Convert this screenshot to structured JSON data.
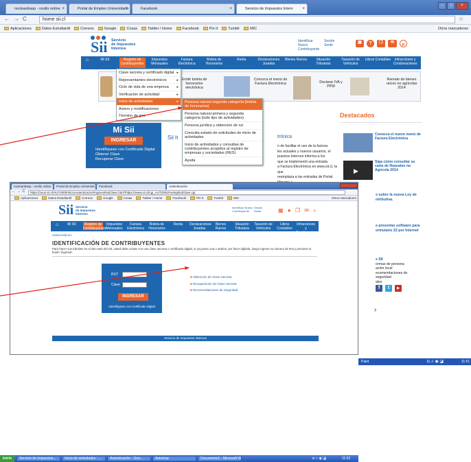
{
  "browser1": {
    "tabs": [
      "nocleanbasp - nosllo online",
      "Portal de Empleo Universitario",
      "Facebook",
      "Servicio de Impuestos Intern"
    ],
    "url": "home sii.cl",
    "bookmarks": [
      "Aplicaciones",
      "Datos Estudiantil",
      "Correos",
      "Google",
      "Cosas",
      "Twitter / Home",
      "Facebook",
      "Pin It",
      "Tumblr",
      "MIC"
    ],
    "other_bookmarks": "Otros marcadores"
  },
  "site": {
    "brand": [
      "Servicio",
      "de Impuestos",
      "Internos"
    ],
    "top_links": [
      "Identificar Nuevo Contribuyente",
      "Sesión Sentir"
    ],
    "nav": [
      "Mi SII",
      "Registro de Contribuyentes",
      "Impuestos Mensuales",
      "Factura Electrónica",
      "Boleta de Honorarios",
      "Renta",
      "Declaraciones Juradas",
      "Bienes Raíces",
      "Situación Tributaria",
      "Tasación de Vehículos",
      "Libros Contables",
      "Infracciones y Condonaciones"
    ]
  },
  "menu": {
    "items": [
      "Clave secreta y certificado digital",
      "Representantes electrónicos",
      "Ciclo de vida de una empresa",
      "Verificación de actividad",
      "Inicio de actividades",
      "Avisos y modificaciones",
      "Término de giro"
    ],
    "highlighted": 4,
    "submenu": [
      "Persona natural segunda categoría (boleta de honorarios)",
      "Persona natural primera y segunda categoría (todo tipo de actividades)",
      "Persona jurídica y obtención de rut",
      "Consulta estado de solicitudes de inicio de actividades",
      "Inicio de actividades y consultas de contribuyentes acogidos al registro de empresas y sociedades (RES)",
      "Ayuda"
    ]
  },
  "banners": [
    "Emitir boleta de honorarios electrónica",
    "Conozca el menú de Factura Electrónica",
    "Declarar IVA y PPM",
    "Remate de bienes raíces no agrícolas 2014"
  ],
  "mi_sii": {
    "title": "Mi Sii",
    "button": "INGRESAR",
    "links": [
      "Identifíquese con Certificado Digital",
      "Obtener Clave",
      "Recuperar Clave"
    ]
  },
  "sii_body": {
    "title": "Sii h",
    "heading": "trónica",
    "lines": [
      "n de facilitar el uso de la factura",
      "les actuales y nuevos usuarios, el",
      "puestos Internos informa a los",
      "que se implementó una entrada",
      "a Factura Electrónica en www.sii.cl, la que",
      "reemplaza a las entradas de Portal Mipyme y"
    ]
  },
  "destacados": {
    "title": "Destacados",
    "items": [
      "Conozca el nuevo menú de Factura Electrónica",
      "Siga cómo consultar su carta de Reavalúo no Agrícola 2014",
      "s sobre la nueva Ley de ntributiva.",
      "e presentar software para ormulario 22 por Internet"
    ],
    "extra": [
      "s SII",
      "ormas de persona",
      "ación local",
      "ecomendaciones de seguridad",
      "ales"
    ],
    "arrow": "›"
  },
  "browser2": {
    "tabs": [
      "nocleanbasp - nosllo online",
      "Portal de Empleo Universita",
      "Facebook",
      "Autenticación"
    ],
    "url": "https://zeus.sii.cl/AUT2000/InicioAutenticacion/IngresoRutClave.html?https://www.sii.cl/cgi_AUT2000/AutIngRutClave.cgi",
    "bookmarks": [
      "Aplicaciones",
      "Datos Estudiantil",
      "Correos",
      "Google",
      "Cosas",
      "Twitter / Home",
      "Facebook",
      "Pin It",
      "Tumblr",
      "MIC"
    ],
    "other_bookmarks": "Otros marcadores",
    "breadcrumb": "Usted está en: ",
    "heading": "IDENTIFICACIÓN DE CONTRIBUYENTES",
    "intro": "Para hacer sus trámites en el sitio web del SII, usted debe contar con una clave secreta o certificado digital, si ya posee una o ambos, por favor digítela, luego ingrese su número de Rut y presione el botón 'Ingresar'.",
    "rut_label": "RUT",
    "clave_label": "Clave",
    "button": "INGRESAR",
    "cert_link": "Identifíquese con Certificado Digital",
    "links": [
      "Obtención de Clave Secreta",
      "Recuperación de Clave Secreta",
      "Recomendaciones de Seguridad"
    ],
    "footer": "Servicio de Impuestos Internos"
  },
  "taskbar_mid": {
    "items": [
      "Paint"
    ],
    "clock": "11:51"
  },
  "taskbar_bottom": {
    "start": "Inicio",
    "items": [
      "Servicio de Impuestos...",
      "Inicio de actividades - ...",
      "Autenticación - Goo...",
      "Autorizar",
      "Documento1 - Microsoft Word"
    ],
    "clock": "11:52"
  },
  "colors": {
    "accent": "#1e67b0",
    "orange": "#e86b2c",
    "arrow": "#e0201e"
  }
}
